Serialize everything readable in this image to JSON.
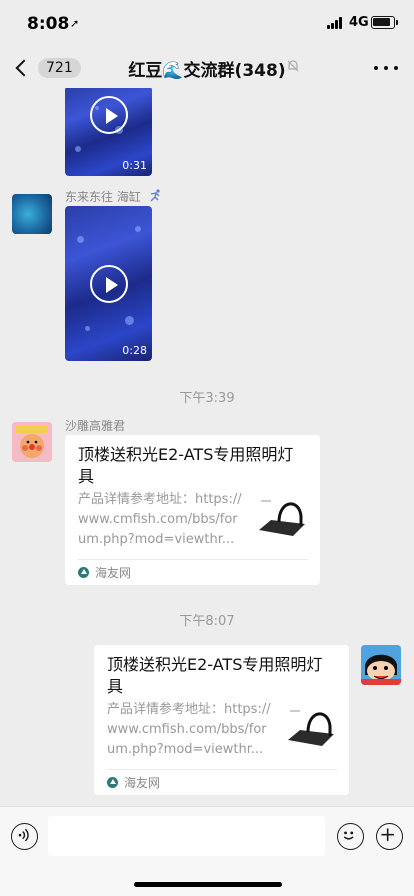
{
  "status_bar": {
    "time": "8:08",
    "network": "4G"
  },
  "nav": {
    "back_count": "721",
    "title": "红豆🌊交流群(348)"
  },
  "messages": {
    "video1": {
      "duration": "0:31"
    },
    "video2": {
      "sender": "东来东往 海缸",
      "duration": "0:28"
    },
    "time1": "下午3:39",
    "link1": {
      "sender": "沙雕高雅君",
      "title": "顶楼送积光E2-ATS专用照明灯具",
      "desc": "产品详情参考地址：https://www.cmfish.com/bbs/forum.php?mod=viewthr...",
      "source": "海友网"
    },
    "time2": "下午8:07",
    "link2": {
      "title": "顶楼送积光E2-ATS专用照明灯具",
      "desc": "产品详情参考地址：https://www.cmfish.com/bbs/forum.php?mod=viewthr...",
      "source": "海友网"
    }
  },
  "icons": {
    "location": "location-arrow-icon",
    "signal": "signal-icon",
    "battery": "battery-icon",
    "back": "chevron-left-icon",
    "mute": "bell-off-icon",
    "more": "more-dots-icon",
    "voice": "voice-icon",
    "emoji": "emoji-icon",
    "plus": "plus-icon",
    "play": "play-icon",
    "runner": "runner-icon",
    "source": "site-icon"
  }
}
